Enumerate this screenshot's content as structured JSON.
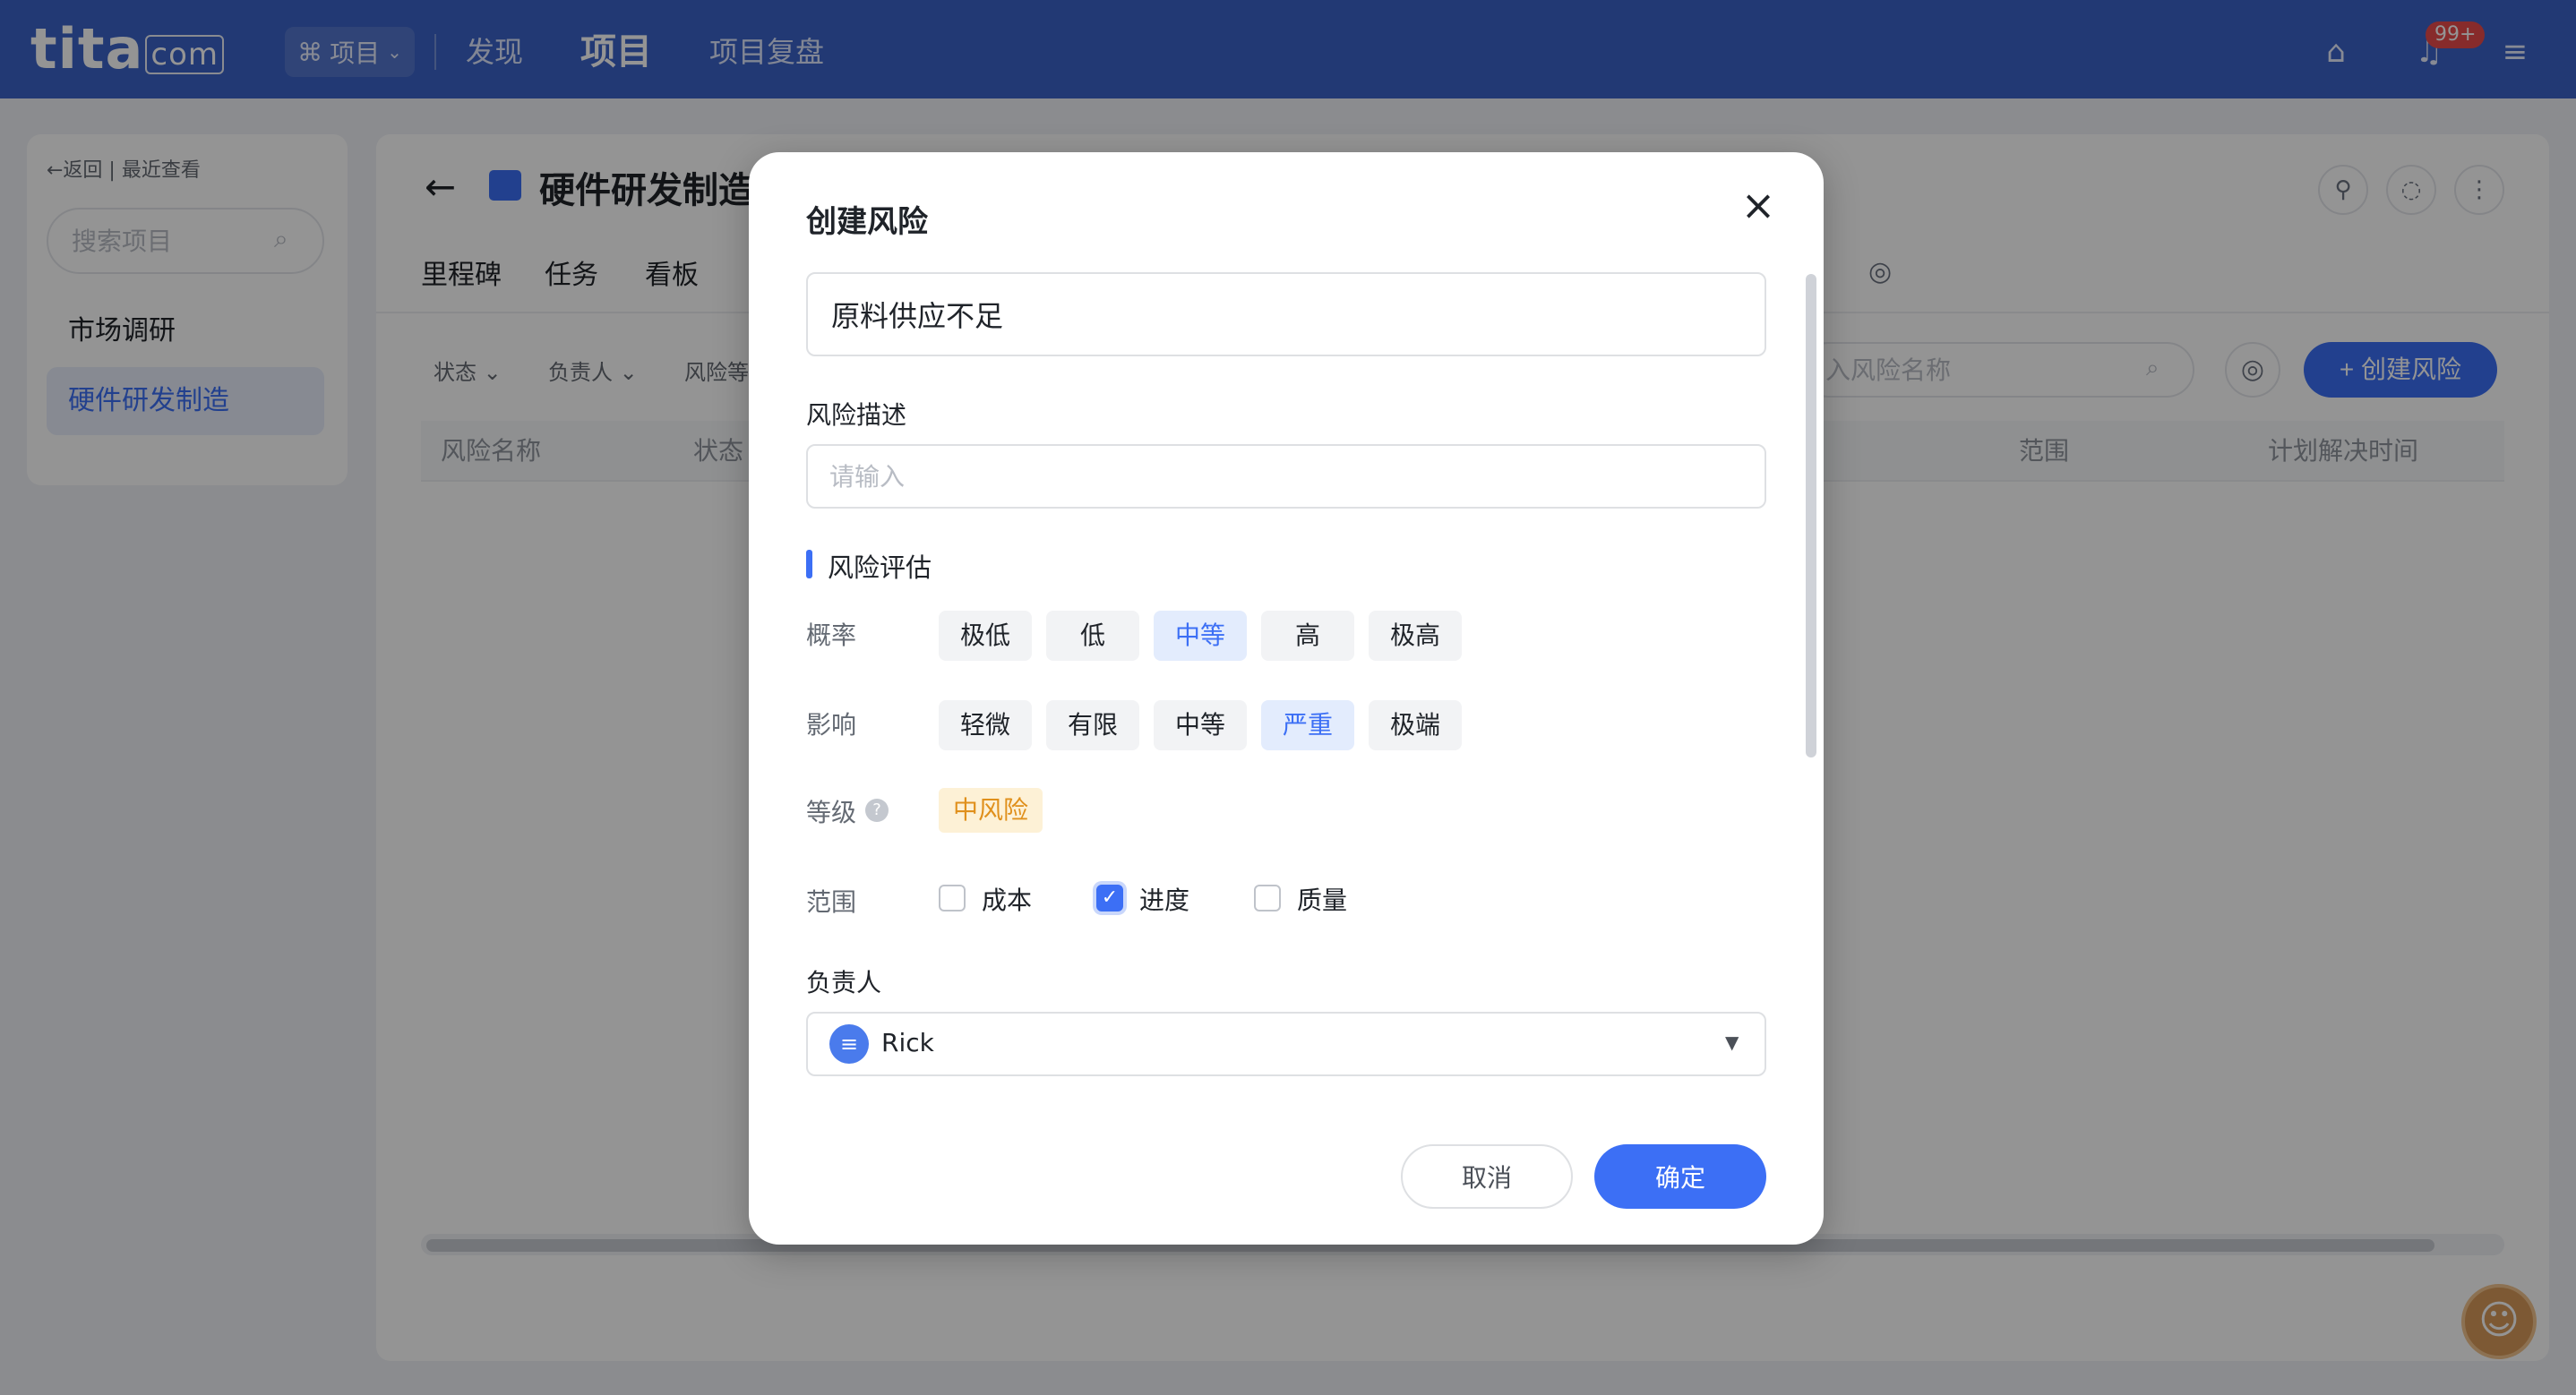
{
  "topbar": {
    "logo": "tita",
    "logo_suffix": "com",
    "switcher_label": "项目",
    "nav": [
      "发现",
      "项目",
      "项目复盘"
    ],
    "notification_badge": "99+"
  },
  "sidebar": {
    "back_label": "←返回 | 最近查看",
    "search_placeholder": "搜索项目",
    "items": [
      {
        "label": "市场调研",
        "active": false
      },
      {
        "label": "硬件研发制造",
        "active": true
      }
    ]
  },
  "main": {
    "title": "硬件研发制造",
    "tabs": [
      "里程碑",
      "任务",
      "看板"
    ],
    "filters": [
      "状态",
      "负责人",
      "风险等"
    ],
    "search_placeholder": "入风险名称",
    "create_button": "+ 创建风险",
    "columns": {
      "name": "风险名称",
      "status": "状态",
      "scope": "范围",
      "plan_time": "计划解决时间"
    }
  },
  "modal": {
    "title": "创建风险",
    "risk_name_value": "原料供应不足",
    "description_label": "风险描述",
    "description_placeholder": "请输入",
    "section_title": "风险评估",
    "probability": {
      "label": "概率",
      "options": [
        "极低",
        "低",
        "中等",
        "高",
        "极高"
      ],
      "selected": "中等"
    },
    "impact": {
      "label": "影响",
      "options": [
        "轻微",
        "有限",
        "中等",
        "严重",
        "极端"
      ],
      "selected": "严重"
    },
    "level": {
      "label": "等级",
      "value": "中风险"
    },
    "scope": {
      "label": "范围",
      "options": [
        {
          "label": "成本",
          "checked": false
        },
        {
          "label": "进度",
          "checked": true
        },
        {
          "label": "质量",
          "checked": false
        }
      ]
    },
    "owner": {
      "label": "负责人",
      "value": "Rick"
    },
    "cancel_label": "取消",
    "confirm_label": "确定"
  },
  "colors": {
    "topbar": "#3c63c8",
    "accent": "#3c6ff5",
    "level_badge_bg": "#fdf1d6",
    "level_badge_text": "#e0901c"
  }
}
